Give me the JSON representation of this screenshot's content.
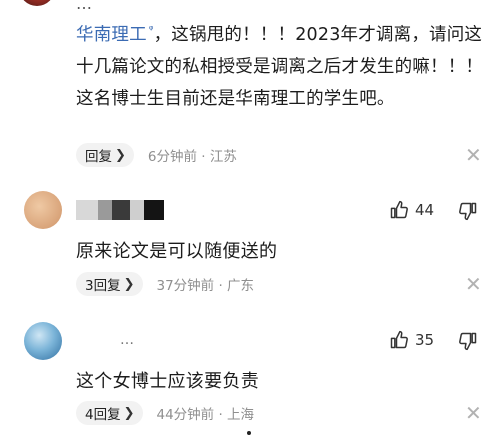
{
  "top_reply": {
    "name_stub": "…",
    "mention": "华南理工",
    "text": "，这锅甩的！！！2023年才调离，请问这十几篇论文的私相授受是调离之后才发生的嘛！！！这名博士生目前还是华南理工的学生吧。",
    "reply_label": "回复",
    "meta": "6分钟前 · 江苏"
  },
  "comments": [
    {
      "text": "原来论文是可以随便送的",
      "likes": "44",
      "reply_label": "3回复",
      "meta": "37分钟前 · 广东"
    },
    {
      "name_stub": "…",
      "text": "这个女博士应该要负责",
      "likes": "35",
      "reply_label": "4回复",
      "meta": "44分钟前 · 上海"
    }
  ],
  "icons": {
    "like": "thumbs-up-icon",
    "dislike": "thumbs-down-icon",
    "close": "close-icon",
    "chevron": "chevron-right-icon"
  },
  "colors": {
    "mention": "#3b6bb3",
    "meta": "#8f8f8f",
    "reply_pill": "#f2f2f2"
  }
}
